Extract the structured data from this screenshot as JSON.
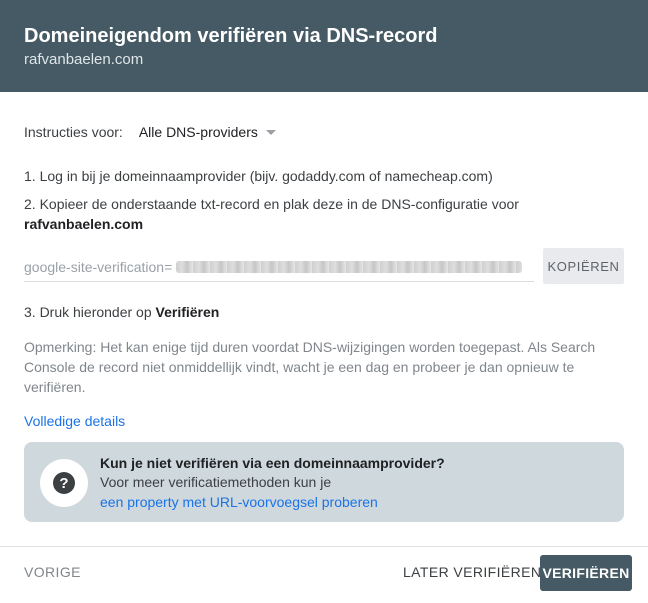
{
  "header": {
    "title": "Domeineigendom verifiëren via DNS-record",
    "domain": "rafvanbaelen.com"
  },
  "instructions": {
    "label": "Instructies voor:",
    "selected_provider": "Alle DNS-providers"
  },
  "steps": {
    "step1": "1. Log in bij je domeinnaamprovider (bijv. godaddy.com of namecheap.com)",
    "step2_text": "2. Kopieer de onderstaande txt-record en plak deze in de DNS-configuratie voor",
    "step2_domain": "rafvanbaelen.com",
    "step3_text": "3. Druk hieronder op",
    "step3_bold": "Verifiëren"
  },
  "txt_record": {
    "prefix": "google-site-verification="
  },
  "copy_button": "KOPIËREN",
  "note": "Opmerking: Het kan enige tijd duren voordat DNS-wijzigingen worden toegepast. Als Search Console de record niet onmiddellijk vindt, wacht je een dag en probeer je dan opnieuw te verifiëren.",
  "details_link": "Volledige details",
  "help": {
    "icon": "question-icon",
    "title": "Kun je niet verifiëren via een domeinnaamprovider?",
    "text": "Voor meer verificatiemethoden kun je",
    "link": "een property met URL-voorvoegsel proberen"
  },
  "footer": {
    "prev": "VORIGE",
    "later": "LATER VERIFIËREN",
    "verify": "VERIFIËREN"
  },
  "colors": {
    "header_bg": "#455a64",
    "link": "#1a73e8",
    "help_bg": "#cfd8dc"
  }
}
